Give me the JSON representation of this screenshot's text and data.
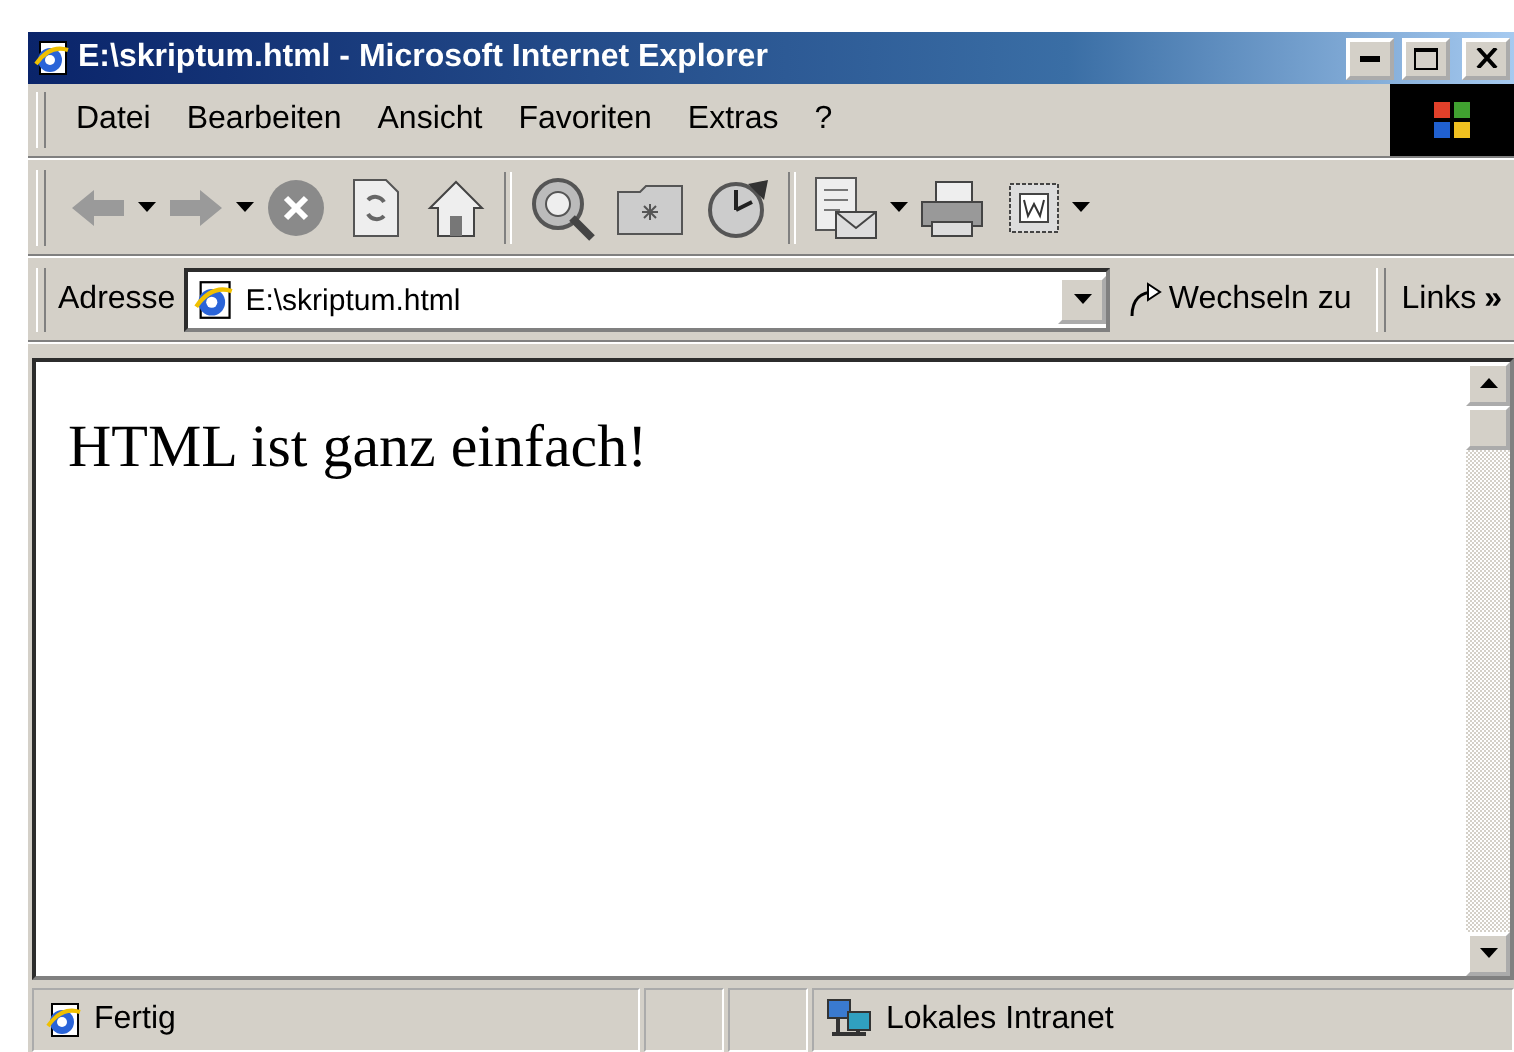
{
  "window": {
    "title": "E:\\skriptum.html - Microsoft Internet Explorer"
  },
  "menu": [
    "Datei",
    "Bearbeiten",
    "Ansicht",
    "Favoriten",
    "Extras",
    "?"
  ],
  "address_bar": {
    "label": "Adresse",
    "value": "E:\\skriptum.html",
    "go": "Wechseln zu",
    "links": "Links",
    "more": "»"
  },
  "content": {
    "text": "HTML ist ganz einfach!"
  },
  "status_bar": {
    "status": "Fertig",
    "zone": "Lokales Intranet"
  }
}
